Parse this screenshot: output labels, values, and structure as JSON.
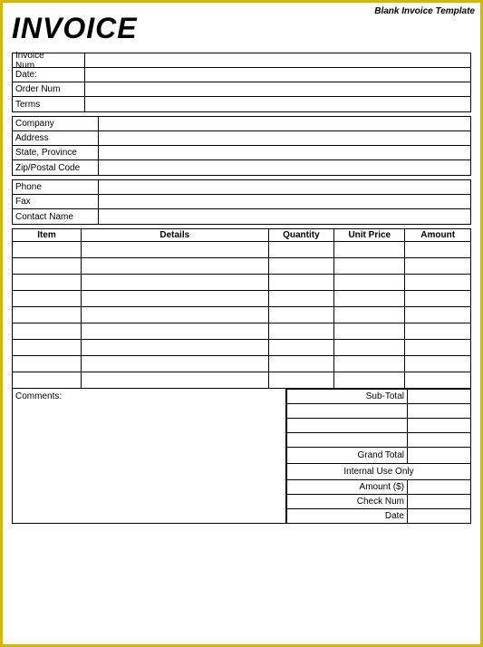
{
  "template": {
    "label": "Blank Invoice Template"
  },
  "header": {
    "title": "INVOICE"
  },
  "invoice_info": {
    "fields": [
      {
        "label": "Invoice Num",
        "value": ""
      },
      {
        "label": "Date:",
        "value": ""
      },
      {
        "label": "Order Num",
        "value": ""
      },
      {
        "label": "Terms",
        "value": ""
      }
    ]
  },
  "company_info": {
    "fields": [
      {
        "label": "Company",
        "value": ""
      },
      {
        "label": "Address",
        "value": ""
      },
      {
        "label": "State, Province",
        "value": ""
      },
      {
        "label": "Zip/Postal Code",
        "value": ""
      }
    ]
  },
  "contact_info": {
    "fields": [
      {
        "label": "Phone",
        "value": ""
      },
      {
        "label": "Fax",
        "value": ""
      },
      {
        "label": "Contact Name",
        "value": ""
      }
    ]
  },
  "table": {
    "headers": [
      "Item",
      "Details",
      "Quantity",
      "Unit Price",
      "Amount"
    ],
    "rows": 9
  },
  "totals": {
    "subtotal_label": "Sub-Total",
    "grand_total_label": "Grand Total",
    "internal_use_label": "Internal Use Only",
    "amount_label": "Amount ($)",
    "check_num_label": "Check Num",
    "date_label": "Date"
  },
  "comments": {
    "label": "Comments:"
  }
}
